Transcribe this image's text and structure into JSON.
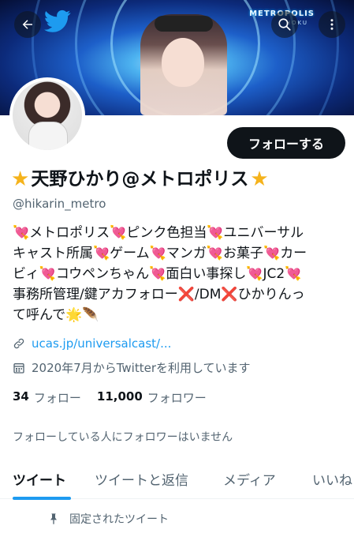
{
  "header": {
    "brand_top": "METROPOLIS",
    "brand_sub": "HOKU"
  },
  "profile": {
    "display_name": "天野ひかり@メトロポリス",
    "handle": "@hikarin_metro",
    "follow_button": "フォローする",
    "bio_lines": [
      [
        "💘",
        "メトロポリス",
        "💘",
        "ピンク色担当",
        "💘",
        "ユニバーサル"
      ],
      [
        "キャスト所属",
        "💘",
        "ゲーム",
        "💘",
        "マンガ",
        "💘",
        "お菓子",
        "💘",
        "カー"
      ],
      [
        "ビィ",
        "💘",
        "コウペンちゃん",
        "💘",
        "面白い事探し",
        "💘",
        "JC2",
        "💘"
      ],
      [
        "事務所管理/鍵アカフォロー",
        "❌",
        "/DM",
        "❌",
        "ひかりんっ"
      ],
      [
        "て呼んで",
        "🌟",
        "🪶"
      ]
    ],
    "link": "ucas.jp/universalcast/...",
    "joined": "2020年7月からTwitterを利用しています",
    "following_count": "34",
    "following_label": "フォロー",
    "followers_count": "11,000",
    "followers_label": "フォロワー",
    "followed_by": "フォローしている人にフォロワーはいません"
  },
  "tabs": [
    {
      "label": "ツイート"
    },
    {
      "label": "ツイートと返信"
    },
    {
      "label": "メディア"
    },
    {
      "label": "いいね"
    }
  ],
  "pinned_label": "固定されたツイート",
  "colors": {
    "accent": "#1d9bf0",
    "text": "#0f1419",
    "muted": "#536471",
    "heart": "#f0486e",
    "star": "#f5b31c"
  }
}
